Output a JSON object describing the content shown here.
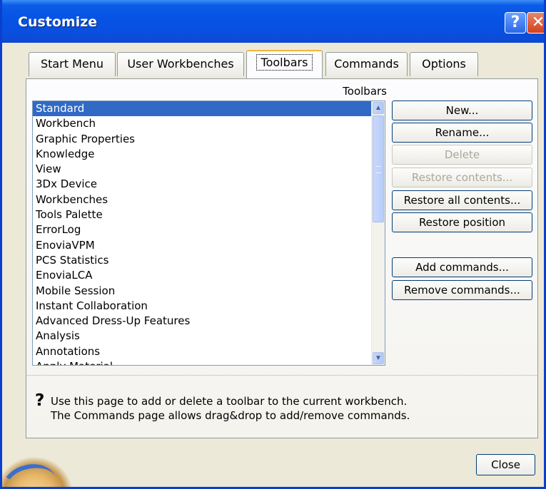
{
  "window": {
    "title": "Customize",
    "help_glyph": "?",
    "close_glyph": "✕"
  },
  "tabs": [
    {
      "label": "Start Menu"
    },
    {
      "label": "User Workbenches"
    },
    {
      "label": "Toolbars"
    },
    {
      "label": "Commands"
    },
    {
      "label": "Options"
    }
  ],
  "active_tab": "Toolbars",
  "toolbars_panel": {
    "list_header": "Toolbars",
    "items": [
      {
        "label": "Standard"
      },
      {
        "label": "Workbench"
      },
      {
        "label": "Graphic Properties"
      },
      {
        "label": "Knowledge"
      },
      {
        "label": "View"
      },
      {
        "label": "3Dx Device"
      },
      {
        "label": "Workbenches"
      },
      {
        "label": "Tools Palette"
      },
      {
        "label": "ErrorLog"
      },
      {
        "label": "EnoviaVPM"
      },
      {
        "label": "PCS Statistics"
      },
      {
        "label": "EnoviaLCA"
      },
      {
        "label": "Mobile Session"
      },
      {
        "label": "Instant Collaboration"
      },
      {
        "label": "Advanced Dress-Up Features"
      },
      {
        "label": "Analysis"
      },
      {
        "label": "Annotations"
      },
      {
        "label": "Apply Material"
      }
    ],
    "selected_item": "Standard",
    "buttons": {
      "new": "New...",
      "rename": "Rename...",
      "delete": "Delete",
      "restore_contents": "Restore contents...",
      "restore_all_contents": "Restore all contents...",
      "restore_position": "Restore position",
      "add_commands": "Add commands...",
      "remove_commands": "Remove commands..."
    },
    "disabled_buttons": [
      "Delete",
      "Restore contents..."
    ],
    "help_icon": "question-icon",
    "help_line1": "Use this page to add or delete a toolbar to the current workbench.",
    "help_line2": "The Commands page allows drag&drop to add/remove commands."
  },
  "footer": {
    "close_label": "Close"
  },
  "colors": {
    "titlebar": "#0653e4",
    "selection": "#316ac5",
    "dialog_bg": "#ece9d8"
  }
}
